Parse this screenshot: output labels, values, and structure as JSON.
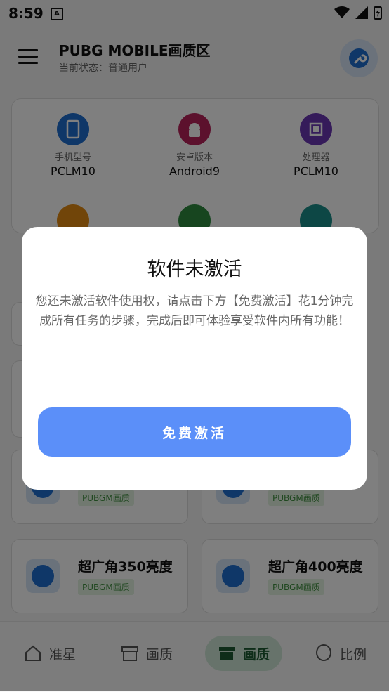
{
  "status_bar": {
    "time": "8:59",
    "app_icon_glyph": "A"
  },
  "header": {
    "title": "PUBG MOBILE画质区",
    "subtitle": "当前状态：普通用户",
    "menu_icon": "hamburger-icon",
    "action_icon": "wrench-icon"
  },
  "device_info": [
    {
      "label": "手机型号",
      "value": "PCLM10",
      "icon": "phone-icon",
      "color": "#1e6fd0"
    },
    {
      "label": "安卓版本",
      "value": "Android9",
      "icon": "android-icon",
      "color": "#b8235a"
    },
    {
      "label": "处理器",
      "value": "PCLM10",
      "icon": "cpu-icon",
      "color": "#6a36b5"
    },
    {
      "icon": "screen-icon",
      "color": "#e28a12"
    },
    {
      "icon": "battery-icon",
      "color": "#2e8b3e"
    },
    {
      "icon": "equalizer-icon",
      "color": "#1a8f8a"
    }
  ],
  "tools": [
    {
      "title": "",
      "tag": "PUBGM画质"
    },
    {
      "title": "",
      "tag": "PUBGM画质"
    },
    {
      "title": "超广角350亮度",
      "tag": "PUBGM画质"
    },
    {
      "title": "超广角400亮度",
      "tag": "PUBGM画质"
    }
  ],
  "bottom_nav": [
    {
      "label": "准星",
      "icon": "home-icon"
    },
    {
      "label": "画质",
      "icon": "archive-icon"
    },
    {
      "label": "画质",
      "icon": "archive-icon",
      "active": true
    },
    {
      "label": "比例",
      "icon": "alien-icon"
    }
  ],
  "dialog": {
    "title": "软件未激活",
    "message": "您还未激活软件使用权，请点击下方【免费激活】花1分钟完成所有任务的步骤，完成后即可体验享受软件内所有功能！",
    "button_label": "免费激活"
  }
}
